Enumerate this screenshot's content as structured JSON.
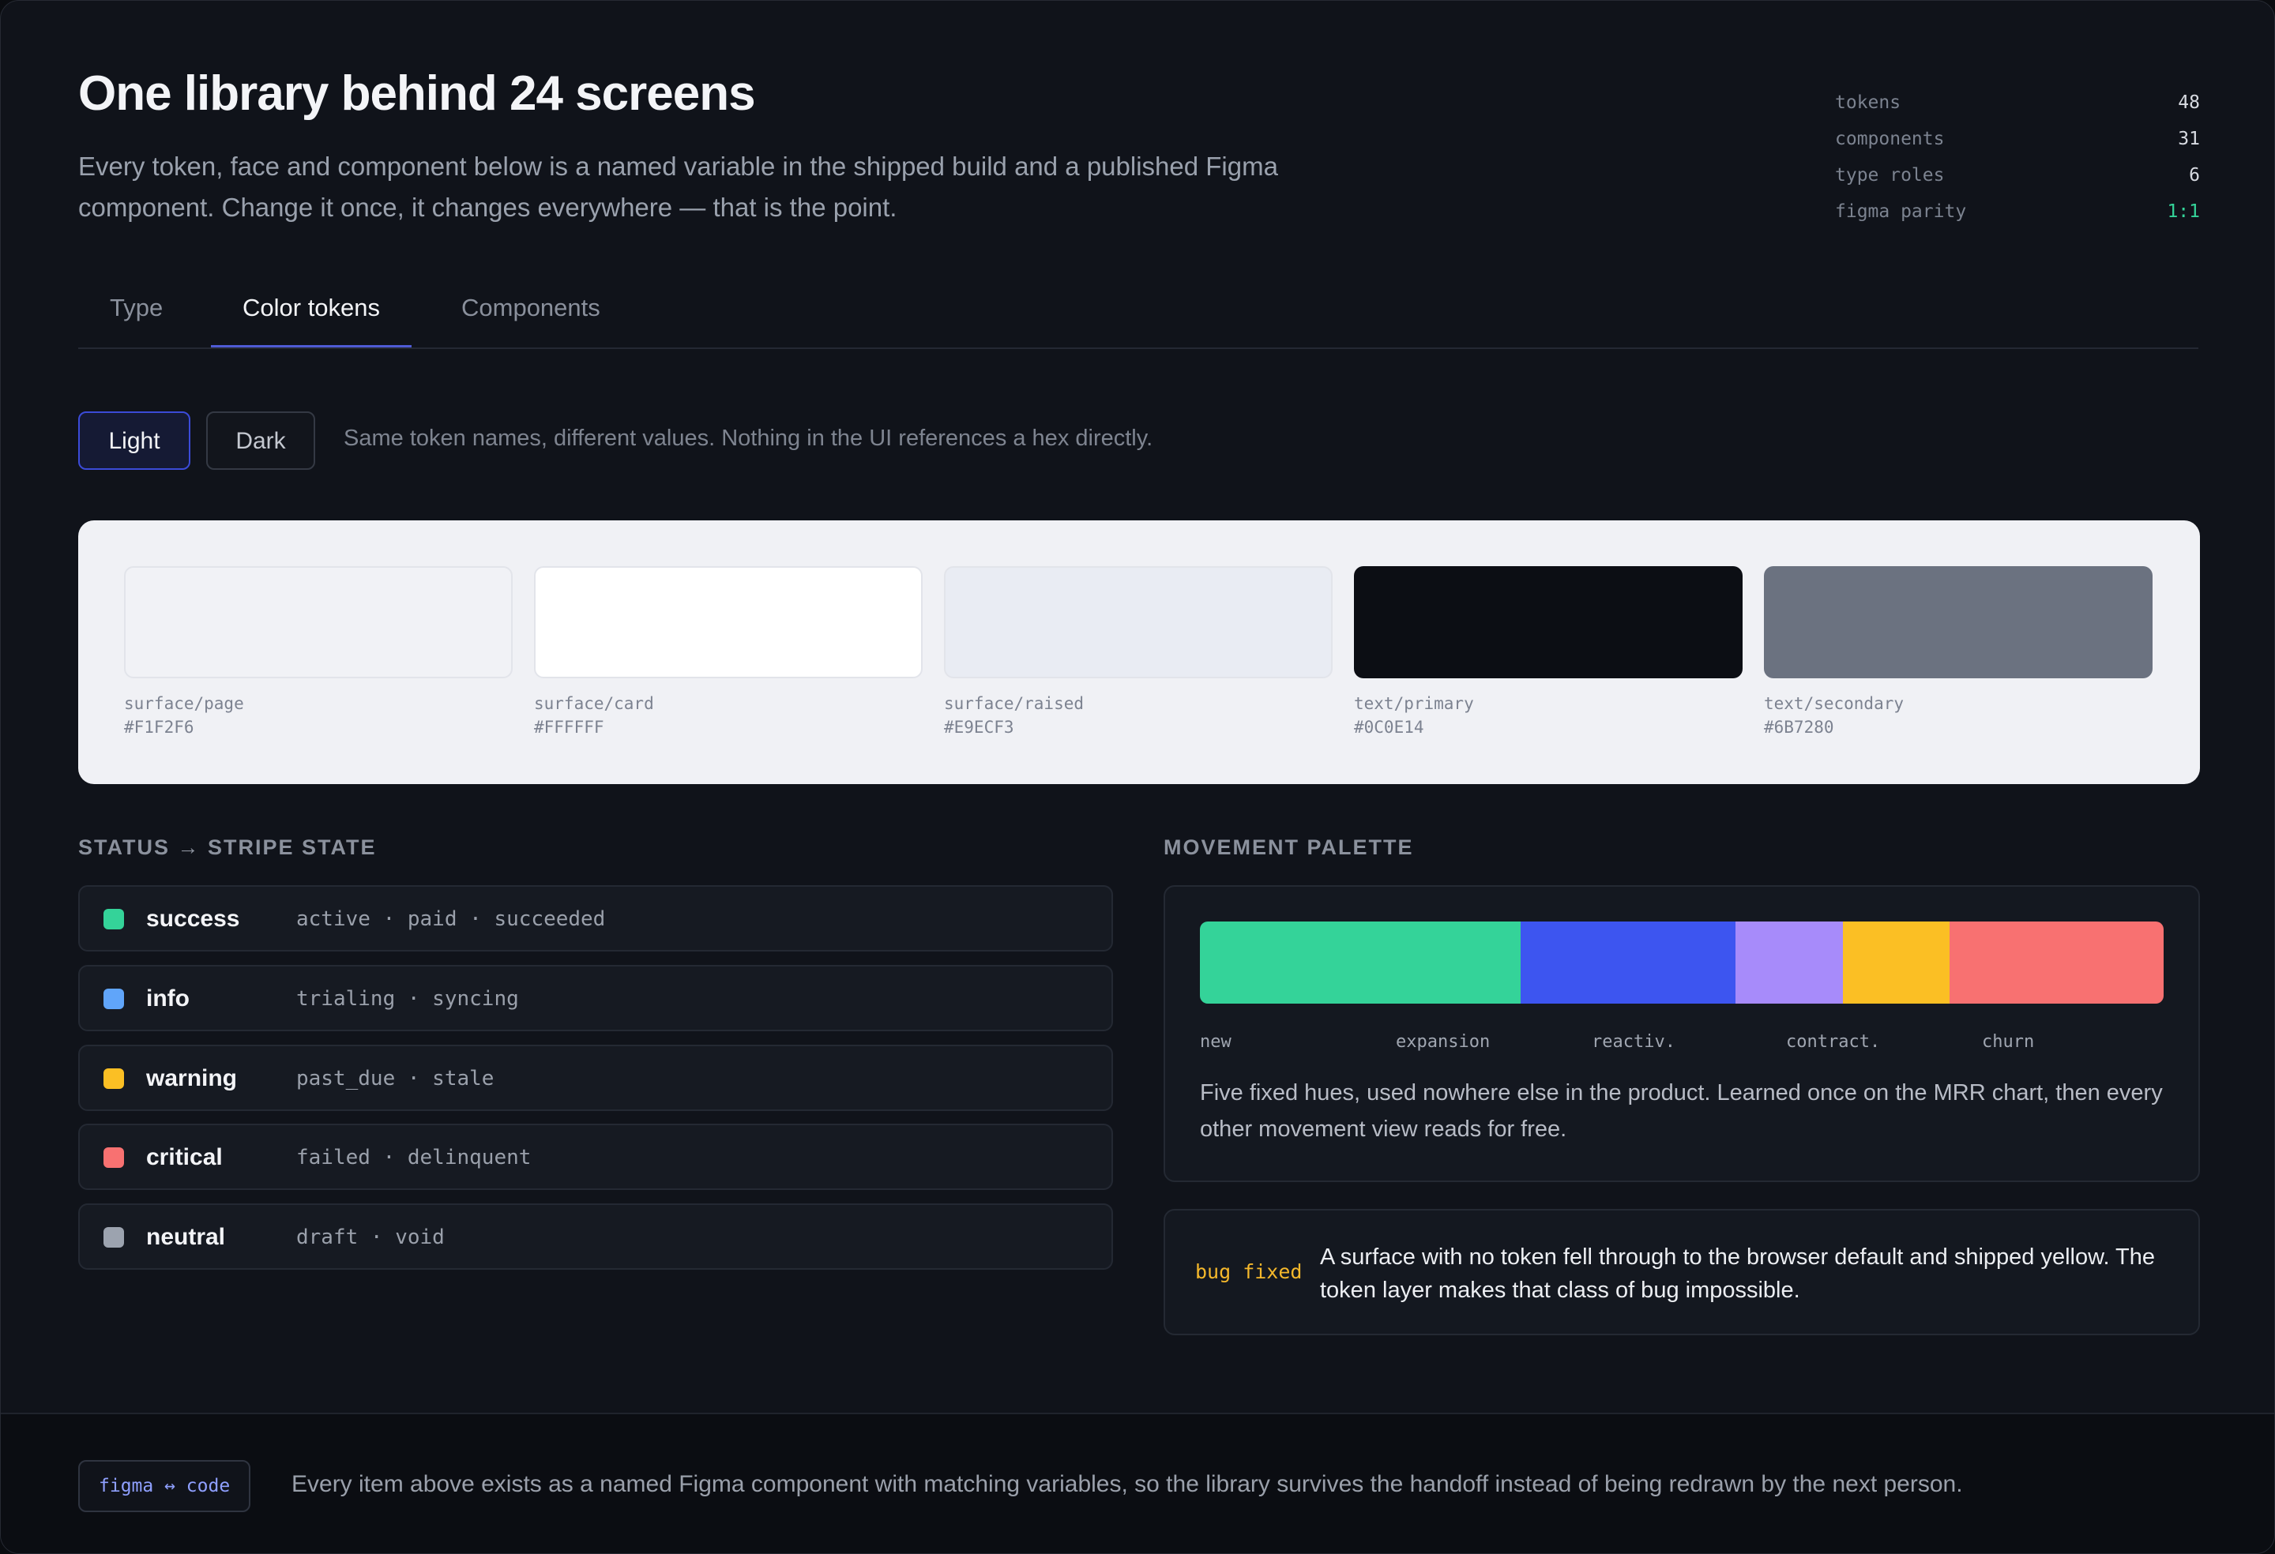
{
  "header": {
    "title": "One library behind 24 screens",
    "subtitle": "Every token, face and component below is a named variable in the shipped build and a published Figma component. Change it once, it changes everywhere — that is the point."
  },
  "stats": [
    {
      "label": "tokens",
      "value": "48"
    },
    {
      "label": "components",
      "value": "31"
    },
    {
      "label": "type roles",
      "value": "6"
    },
    {
      "label": "figma parity",
      "value": "1:1"
    }
  ],
  "tabs": [
    {
      "label": "Type"
    },
    {
      "label": "Color tokens",
      "active": true
    },
    {
      "label": "Components"
    }
  ],
  "theme": {
    "light_label": "Light",
    "dark_label": "Dark",
    "selected": "Light",
    "note": "Same token names, different values. Nothing in the UI references a hex directly."
  },
  "tokens": [
    {
      "name": "surface/page",
      "hex": "#F1F2F6"
    },
    {
      "name": "surface/card",
      "hex": "#FFFFFF"
    },
    {
      "name": "surface/raised",
      "hex": "#E9ECF3"
    },
    {
      "name": "text/primary",
      "hex": "#0C0E14"
    },
    {
      "name": "text/secondary",
      "hex": "#6B7280"
    }
  ],
  "status": {
    "heading": "STATUS → STRIPE STATE",
    "rows": [
      {
        "name": "success",
        "states": "active · paid · succeeded",
        "color": "#34d399"
      },
      {
        "name": "info",
        "states": "trialing · syncing",
        "color": "#60a5fa"
      },
      {
        "name": "warning",
        "states": "past_due · stale",
        "color": "#fbbf24"
      },
      {
        "name": "critical",
        "states": "failed · delinquent",
        "color": "#f87171"
      },
      {
        "name": "neutral",
        "states": "draft · void",
        "color": "#9ca3af"
      }
    ]
  },
  "movement": {
    "heading": "MOVEMENT PALETTE",
    "segments": [
      {
        "label": "new",
        "color": "#34d399",
        "share": 0.333
      },
      {
        "label": "expansion",
        "color": "#3d55f0",
        "share": 0.223
      },
      {
        "label": "reactiv.",
        "color": "#a78bfa",
        "share": 0.111
      },
      {
        "label": "contract.",
        "color": "#fbbf24",
        "share": 0.111
      },
      {
        "label": "churn",
        "color": "#f87171",
        "share": 0.222
      }
    ],
    "description": "Five fixed hues, used nowhere else in the product. Learned once on the MRR chart, then every other movement view reads for free."
  },
  "bug": {
    "tag": "bug fixed",
    "text": "A surface with no token fell through to the browser default and shipped yellow. The token layer makes that class of bug impossible."
  },
  "footer": {
    "badge": "figma ↔ code",
    "text": "Every item above exists as a named Figma component with matching variables, so the library survives the handoff instead of being redrawn by the next person."
  }
}
